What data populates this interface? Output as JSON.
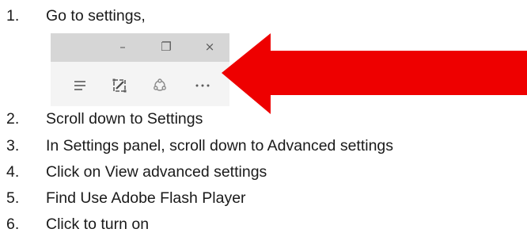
{
  "steps": [
    {
      "number": "1.",
      "text": "Go to settings,"
    },
    {
      "number": "2.",
      "text": "Scroll down to Settings"
    },
    {
      "number": "3.",
      "text": "In Settings panel, scroll down to Advanced settings"
    },
    {
      "number": "4.",
      "text": "Click on View advanced settings"
    },
    {
      "number": "5.",
      "text": "Find Use Adobe Flash Player"
    },
    {
      "number": "6.",
      "text": "Click to turn on"
    }
  ],
  "browser": {
    "window_controls": {
      "minimize": "–",
      "restore": "❐",
      "close": "×"
    },
    "toolbar_icons": [
      "hub-icon",
      "web-note-icon",
      "share-icon",
      "more-actions-icon"
    ],
    "more_label": "···"
  },
  "colors": {
    "arrow": "#ee0000",
    "title_bar": "#d6d6d6",
    "toolbar": "#f4f4f4",
    "icon": "#5a5a5a"
  }
}
